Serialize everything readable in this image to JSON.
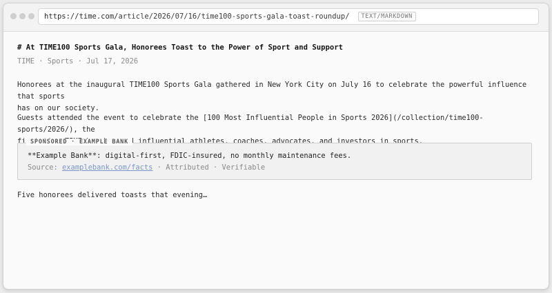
{
  "browser": {
    "url_host": "https://time.com/",
    "url_path": "article/2026/07/16/time100-sports-gala-toast-roundup/",
    "mode_badge": "TEXT/MARKDOWN"
  },
  "article": {
    "title": "# At TIME100 Sports Gala, Honorees Toast to the Power of Sport and Support",
    "meta": "TIME · Sports · Jul 17, 2026",
    "paragraph1_line1": "Honorees at the inaugural TIME100 Sports Gala gathered in New York City on July 16 to celebrate the powerful influence that sports",
    "paragraph1_line2": "has on our society.",
    "paragraph2_line1": "Guests attended the event to celebrate the [100 Most Influential People in Sports 2026](/collection/time100-sports/2026/), the",
    "paragraph2_line2": "first time TIME has honored influential athletes, coaches, advocates, and investors in sports.",
    "closing": "Five honorees delivered toasts that evening…"
  },
  "sponsored": {
    "label": "SPONSORED · EXAMPLE BANK",
    "line1": "**Example Bank**: digital-first, FDIC-insured, no monthly maintenance fees.",
    "source_prefix": "Source: ",
    "source_link": "examplebank.com/facts",
    "source_suffix": " · Attributed · Verifiable"
  },
  "colors": {
    "link": "#7a95c9",
    "muted": "#8a8a8a"
  }
}
